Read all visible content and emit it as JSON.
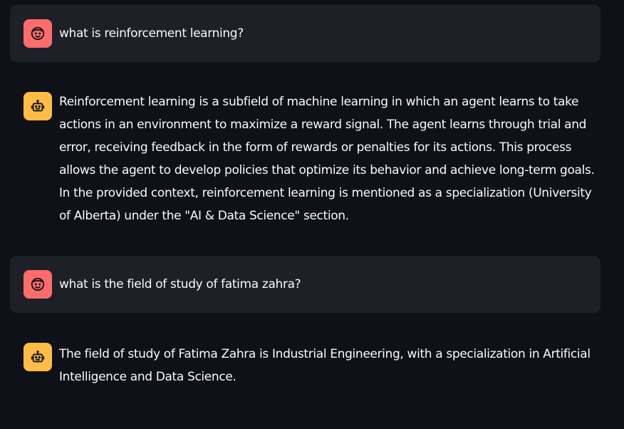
{
  "messages": [
    {
      "role": "user",
      "avatar_icon": "user-face-icon",
      "text": "what is reinforcement learning?"
    },
    {
      "role": "assistant",
      "avatar_icon": "robot-icon",
      "text": "Reinforcement learning is a subfield of machine learning in which an agent learns to take actions in an environment to maximize a reward signal. The agent learns through trial and error, receiving feedback in the form of rewards or penalties for its actions. This process allows the agent to develop policies that optimize its behavior and achieve long-term goals. In the provided context, reinforcement learning is mentioned as a specialization (University of Alberta) under the \"AI & Data Science\" section."
    },
    {
      "role": "user",
      "avatar_icon": "user-face-icon",
      "text": "what is the field of study of fatima zahra?"
    },
    {
      "role": "assistant",
      "avatar_icon": "robot-icon",
      "text": "The field of study of Fatima Zahra is Industrial Engineering, with a specialization in Artificial Intelligence and Data Science."
    }
  ],
  "colors": {
    "background": "#0e1117",
    "user_message_bg": "#1e2028",
    "user_avatar": "#ff6c6c",
    "assistant_avatar": "#ffbd45",
    "text": "#fafafa"
  }
}
